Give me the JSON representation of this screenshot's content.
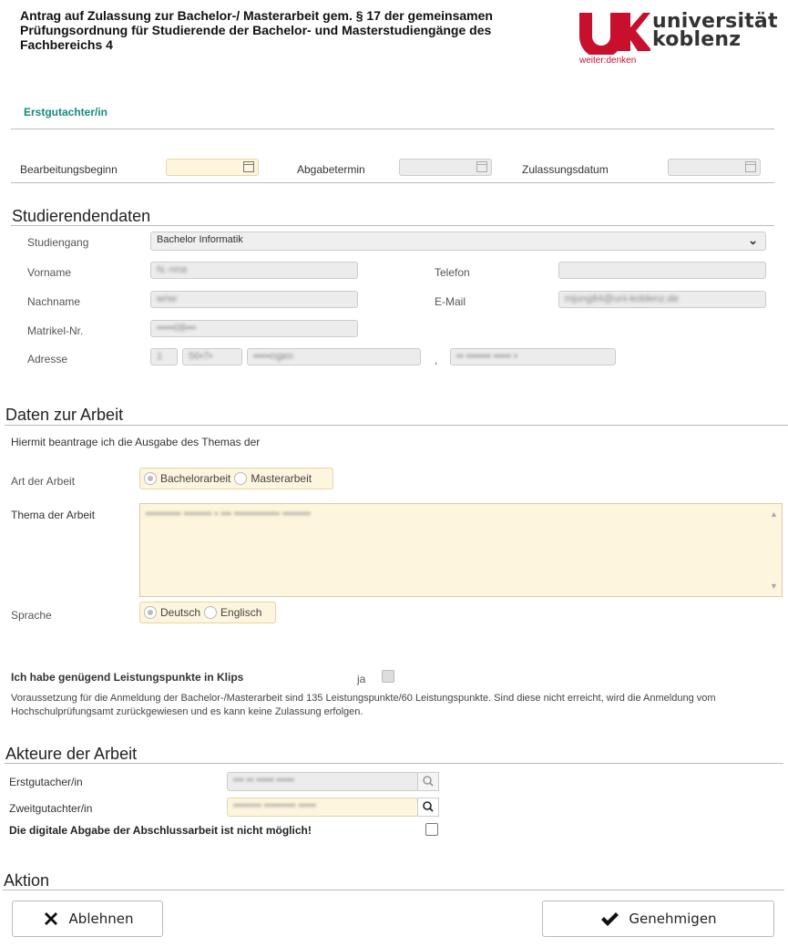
{
  "header": {
    "title": "Antrag auf Zulassung zur Bachelor-/ Masterarbeit gem. § 17 der gemeinsamen Prüfungsordnung für Studierende der Bachelor- und Masterstudiengänge des Fachbereichs 4",
    "logo_line1": "universität",
    "logo_line2": "koblenz",
    "logo_tagline": "weiter:denken",
    "brand_color": "#c8102e"
  },
  "role_label": "Erstgutachter/in",
  "dates": {
    "bearbeitungsbeginn_label": "Bearbeitungsbeginn",
    "bearbeitungsbeginn_value": "",
    "abgabetermin_label": "Abgabetermin",
    "abgabetermin_value": "",
    "zulassungsdatum_label": "Zulassungsdatum",
    "zulassungsdatum_value": ""
  },
  "student": {
    "section_title": "Studierendendaten",
    "studiengang_label": "Studiengang",
    "studiengang_value": "Bachelor Informatik",
    "vorname_label": "Vorname",
    "vorname_value": "N.-nna",
    "telefon_label": "Telefon",
    "telefon_value": "",
    "nachname_label": "Nachname",
    "nachname_value": "wnw",
    "email_label": "E-Mail",
    "email_value": "mjung84@uni-koblenz.de",
    "matrikel_label": "Matrikel-Nr.",
    "matrikel_value": "•••••08•••",
    "adresse_label": "Adresse",
    "adresse_nr": "1",
    "adresse_plz": "56•7•",
    "adresse_ort": "•••••ngen",
    "adresse_sep": ",",
    "adresse_strasse": "•• ••••••• ••••• •"
  },
  "thesis": {
    "section_title": "Daten zur Arbeit",
    "intro": "Hiermit beantrage ich die Ausgabe des Themas der",
    "art_label": "Art der Arbeit",
    "art_option1": "Bachelorarbeit",
    "art_option2": "Masterarbeit",
    "thema_label": "Thema der Arbeit",
    "thema_value": "•••••••••• •••••••• • ••• ••••••••••••• ••••••••",
    "sprache_label": "Sprache",
    "sprache_option1": "Deutsch",
    "sprache_option2": "Englisch",
    "lp_label": "Ich habe genügend Leistungspunkte in Klips",
    "lp_ja": "ja",
    "lp_note": "Voraussetzung für die Anmeldung der Bachelor-/Masterarbeit sind 135 Leistungspunkte/60 Leistungspunkte. Sind diese nicht erreicht, wird die Anmeldung vom Hochschulprüfungsamt zurückgewiesen und es kann keine Zulassung erfolgen."
  },
  "actors": {
    "section_title": "Akteure der Arbeit",
    "erst_label": "Erstgutacher/in",
    "erst_value": "••• •• ••••• •••••",
    "zweit_label": "Zweitgutachter/in",
    "zweit_value": "•••••••• ••••••••• •••••",
    "digital_label": "Die digitale Abgabe der Abschlussarbeit ist nicht möglich!"
  },
  "action": {
    "section_title": "Aktion",
    "reject_label": "Ablehnen",
    "approve_label": "Genehmigen"
  }
}
